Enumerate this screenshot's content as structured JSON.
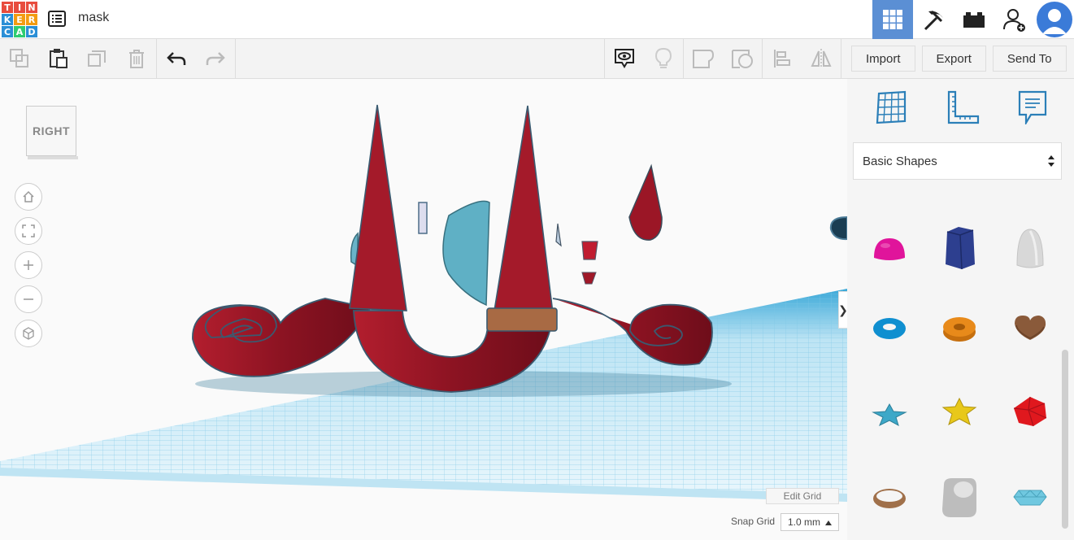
{
  "app": {
    "logo_letters": [
      "T",
      "I",
      "N",
      "K",
      "E",
      "R",
      "C",
      "A",
      "D"
    ],
    "logo_colors": [
      "#e84c3d",
      "#e84c3d",
      "#e84c3d",
      "#2b8fd6",
      "#f39c12",
      "#f39c12",
      "#2b8fd6",
      "#2ecc71",
      "#2b8fd6"
    ],
    "design_title": "mask"
  },
  "header_right": {
    "items": [
      "grid-3d-icon",
      "pickaxe-icon",
      "bricks-icon",
      "add-user-icon",
      "avatar"
    ],
    "active_color": "#5b8fd4"
  },
  "toolbar": {
    "left_icons": [
      "copy-icon",
      "paste-icon",
      "duplicate-icon",
      "delete-icon",
      "undo-icon",
      "redo-icon"
    ],
    "right_icons": [
      "notes-icon",
      "light-icon",
      "shape-icon",
      "hole-icon",
      "align-icon",
      "mirror-icon"
    ],
    "import_label": "Import",
    "export_label": "Export",
    "send_to_label": "Send To"
  },
  "viewport": {
    "viewcube_label": "RIGHT",
    "edit_grid_label": "Edit Grid",
    "snap_grid_label": "Snap Grid",
    "snap_grid_value": "1.0 mm",
    "collapse_glyph": "❯"
  },
  "panel": {
    "top_icons": [
      "workplane-icon",
      "ruler-icon",
      "notes-panel-icon"
    ],
    "library_label": "Basic Shapes",
    "shapes": [
      {
        "name": "half-sphere",
        "color": "#e0149b"
      },
      {
        "name": "polygon",
        "color": "#2d3f8f"
      },
      {
        "name": "paraboloid",
        "color": "#d8d8d8"
      },
      {
        "name": "torus",
        "color": "#0f8fd0"
      },
      {
        "name": "tube",
        "color": "#e88a1a"
      },
      {
        "name": "heart",
        "color": "#8a5a3a"
      },
      {
        "name": "star-blue",
        "color": "#3ea8c8"
      },
      {
        "name": "star-yellow",
        "color": "#e8c81a"
      },
      {
        "name": "icosahedron",
        "color": "#e0181e"
      },
      {
        "name": "ring",
        "color": "#a0704a"
      },
      {
        "name": "rounded-box",
        "color": "#bdbdbd"
      },
      {
        "name": "gem",
        "color": "#70c8e0"
      }
    ]
  }
}
